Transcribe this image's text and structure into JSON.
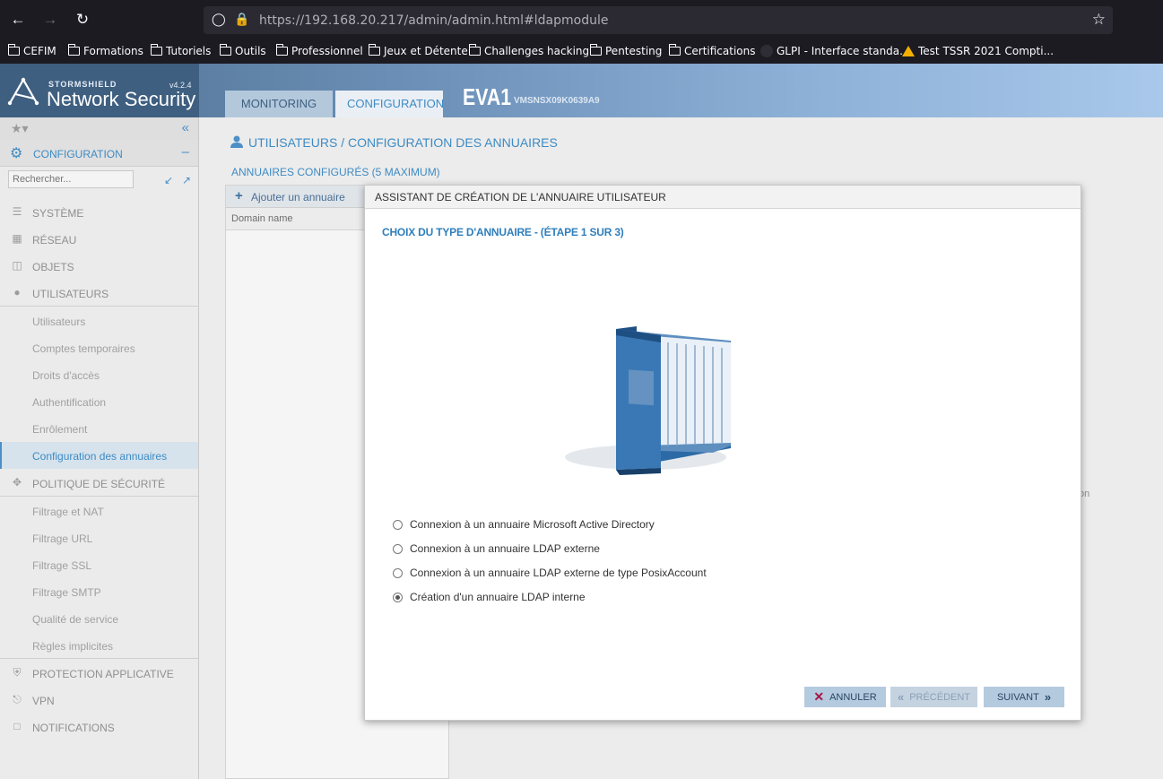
{
  "browser": {
    "url_host": "https://192.168.20.217",
    "url_path": "/admin/admin.html#ldapmodule",
    "bookmarks": [
      {
        "label": "CEFIM",
        "icon": "folder-icon"
      },
      {
        "label": "Formations",
        "icon": "folder-icon"
      },
      {
        "label": "Tutoriels",
        "icon": "folder-icon"
      },
      {
        "label": "Outils",
        "icon": "folder-icon"
      },
      {
        "label": "Professionnel",
        "icon": "folder-icon"
      },
      {
        "label": "Jeux et Détente",
        "icon": "folder-icon"
      },
      {
        "label": "Challenges hacking",
        "icon": "folder-icon"
      },
      {
        "label": "Pentesting",
        "icon": "folder-icon"
      },
      {
        "label": "Certifications",
        "icon": "folder-icon"
      },
      {
        "label": "GLPI - Interface standa...",
        "icon": "glpi-icon"
      },
      {
        "label": "Test TSSR 2021 Compti...",
        "icon": "google-drive-icon"
      }
    ]
  },
  "app": {
    "brand_sub": "STORMSHIELD",
    "brand_main": "Network Security",
    "version": "v4.2.4",
    "tabs": [
      "MONITORING",
      "CONFIGURATION"
    ],
    "firewall_name": "EVA1",
    "firewall_serial": "VMSNSX09K0639A9"
  },
  "sidebar": {
    "section_label": "CONFIGURATION",
    "search_placeholder": "Rechercher...",
    "items": [
      {
        "label": "SYSTÈME",
        "type": "top"
      },
      {
        "label": "RÉSEAU",
        "type": "top"
      },
      {
        "label": "OBJETS",
        "type": "top"
      },
      {
        "label": "UTILISATEURS",
        "type": "top"
      },
      {
        "label": "Utilisateurs",
        "type": "sub"
      },
      {
        "label": "Comptes temporaires",
        "type": "sub"
      },
      {
        "label": "Droits d'accès",
        "type": "sub"
      },
      {
        "label": "Authentification",
        "type": "sub"
      },
      {
        "label": "Enrôlement",
        "type": "sub"
      },
      {
        "label": "Configuration des annuaires",
        "type": "sub-active"
      },
      {
        "label": "POLITIQUE DE SÉCURITÉ",
        "type": "top"
      },
      {
        "label": "Filtrage et NAT",
        "type": "sub"
      },
      {
        "label": "Filtrage URL",
        "type": "sub"
      },
      {
        "label": "Filtrage SSL",
        "type": "sub"
      },
      {
        "label": "Filtrage SMTP",
        "type": "sub"
      },
      {
        "label": "Qualité de service",
        "type": "sub"
      },
      {
        "label": "Règles implicites",
        "type": "sub"
      },
      {
        "label": "PROTECTION APPLICATIVE",
        "type": "top"
      },
      {
        "label": "VPN",
        "type": "top"
      },
      {
        "label": "NOTIFICATIONS",
        "type": "top"
      }
    ]
  },
  "main": {
    "title": "UTILISATEURS / CONFIGURATION DES ANNUAIRES",
    "configured_label": "ANNUAIRES CONFIGURÉS (5 MAXIMUM)",
    "add_button": "Ajouter un annuaire",
    "column_header": "Domain name",
    "partial_text": "on"
  },
  "dialog": {
    "title": "ASSISTANT DE CRÉATION DE L'ANNUAIRE UTILISATEUR",
    "step": "CHOIX DU TYPE D'ANNUAIRE - (ÉTAPE 1 SUR 3)",
    "options": [
      {
        "label": "Connexion à un annuaire Microsoft Active Directory",
        "selected": false
      },
      {
        "label": "Connexion à un annuaire LDAP externe",
        "selected": false
      },
      {
        "label": "Connexion à un annuaire LDAP externe de type PosixAccount",
        "selected": false
      },
      {
        "label": "Création d'un annuaire LDAP interne",
        "selected": true
      }
    ],
    "buttons": {
      "cancel": "ANNULER",
      "previous": "PRÉCÉDENT",
      "next": "SUIVANT"
    }
  },
  "colors": {
    "accent": "#3d8bc4",
    "header_gradient_start": "#4e6f90",
    "header_gradient_end": "#a9c8ea",
    "button_bg": "#b4cadf",
    "cancel_x": "#a8154a"
  }
}
